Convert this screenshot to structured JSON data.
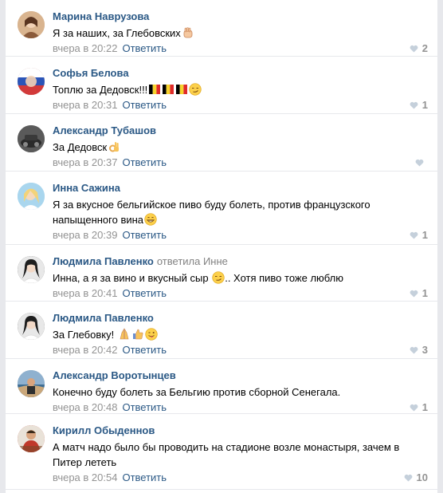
{
  "reply_label": "Ответить",
  "comments": [
    {
      "author": "Марина Наврузова",
      "reply_to": "",
      "text": "Я за наших, за Глебовских",
      "emojis": [
        "raised-fist"
      ],
      "date": "вчера в 20:22",
      "likes": "2",
      "avatar_color": "#c9a07a"
    },
    {
      "author": "Софья Белова",
      "reply_to": "",
      "text": "Топлю за Дедовск!!!",
      "emojis": [
        "flag-belgium",
        "flag-belgium",
        "flag-belgium",
        "smirk"
      ],
      "date": "вчера в 20:31",
      "likes": "1",
      "avatar_color": "#b84a4a"
    },
    {
      "author": "Александр Тубашов",
      "reply_to": "",
      "text": "За Дедовск",
      "emojis": [
        "ok-hand"
      ],
      "date": "вчера в 20:37",
      "likes": "",
      "avatar_color": "#555555"
    },
    {
      "author": "Инна Сажина",
      "reply_to": "",
      "text": "Я за вкусное бельгийское пиво буду болеть, против французского напыщенного вина",
      "emojis": [
        "grin"
      ],
      "date": "вчера в 20:39",
      "likes": "1",
      "avatar_color": "#8ec6e6"
    },
    {
      "author": "Людмила Павленко",
      "reply_to": "ответила Инне",
      "text": "Инна, а я за вино и вкусный сыр",
      "text_after": ".. Хотя пиво тоже люблю",
      "emojis": [
        "smirk"
      ],
      "date": "вчера в 20:41",
      "likes": "1",
      "avatar_color": "#3a3a3a"
    },
    {
      "author": "Людмила Павленко",
      "reply_to": "",
      "text": "За Глебовку!",
      "emojis": [
        "pray",
        "thumbs-up",
        "wink-tongue"
      ],
      "date": "вчера в 20:42",
      "likes": "3",
      "avatar_color": "#3a3a3a"
    },
    {
      "author": "Александр Воротынцев",
      "reply_to": "",
      "text": "Конечно буду болеть за Бельгию против сборной Сенегала.",
      "emojis": [],
      "date": "вчера в 20:48",
      "likes": "1",
      "avatar_color": "#7a93a8"
    },
    {
      "author": "Кирилл Обыденнов",
      "reply_to": "",
      "text": "А матч надо было бы проводить на стадионе возле монастыря, зачем в Питер лететь",
      "emojis": [],
      "date": "вчера в 20:54",
      "likes": "10",
      "avatar_color": "#c0392b"
    }
  ],
  "colors": {
    "link": "#2a5885",
    "muted": "#939393",
    "divider": "#e7e8ec"
  }
}
